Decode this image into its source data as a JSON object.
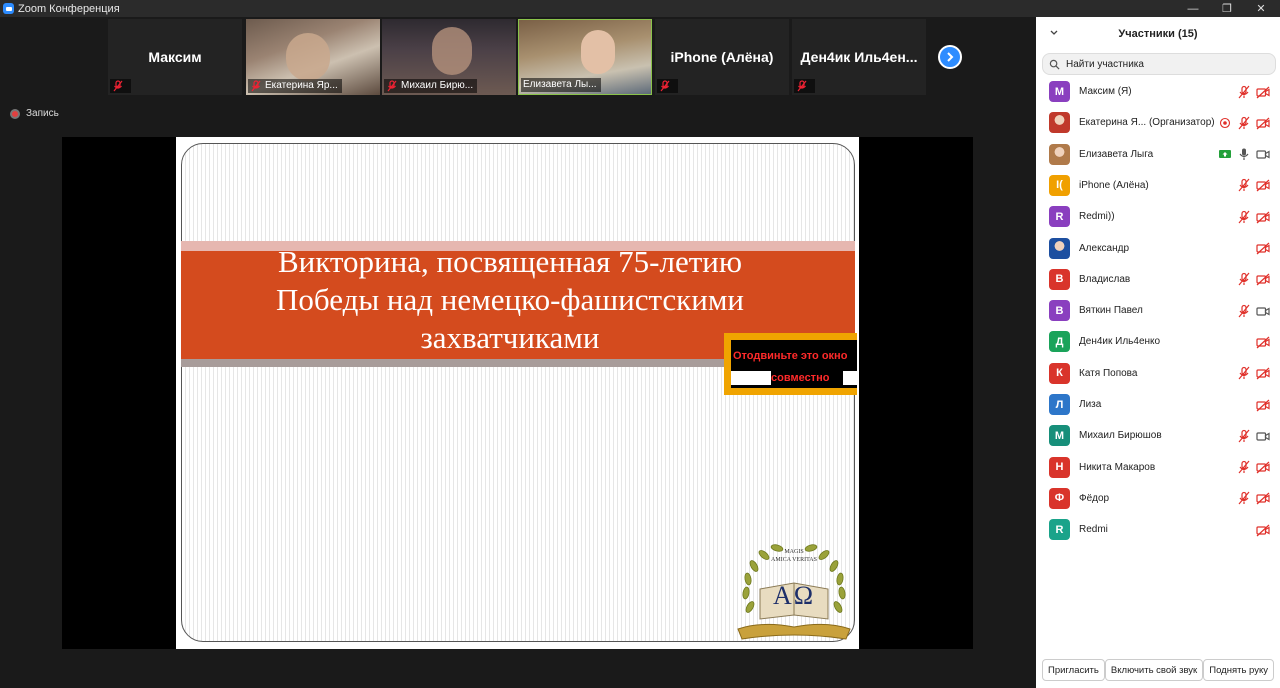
{
  "window": {
    "title": "Zoom Конференция"
  },
  "gallery": {
    "tiles": [
      {
        "name": "Максим",
        "kind": "name"
      },
      {
        "name": "Екатерина Яр...",
        "kind": "video"
      },
      {
        "name": "Михаил Бирю...",
        "kind": "video"
      },
      {
        "name": "Елизавета Лы...",
        "kind": "video"
      },
      {
        "name": "iPhone (Алёна)",
        "kind": "name"
      },
      {
        "name": "Ден4ик  Иль4ен...",
        "kind": "name"
      }
    ]
  },
  "recording": {
    "label": "Запись"
  },
  "slide": {
    "title_line1": "Викторина, посвященная 75-летию",
    "title_line2": "Победы над немецко-фашистскими",
    "title_line3": "захватчиками",
    "notice_line1": "Отодвиньте это окно",
    "notice_line2": "совместно",
    "emblem_text1": "MAGIS",
    "emblem_text2": "AMICA VERITAS",
    "emblem_letters": "ΑΩ"
  },
  "panel": {
    "title": "Участники (15)",
    "search_placeholder": "Найти участника",
    "participants": [
      {
        "name": "Максим  (Я)",
        "initial": "М",
        "color": "#8a3fbf",
        "mic": "off",
        "cam": "off"
      },
      {
        "name": "Екатерина Я...  (Организатор)",
        "initial": "",
        "color": "#c0392b",
        "mic": "off",
        "cam": "off",
        "rec": true
      },
      {
        "name": "Елизавета Лыга",
        "initial": "",
        "color": "#b07a4a",
        "mic": "on",
        "cam": "on",
        "share": true
      },
      {
        "name": "iPhone (Алёна)",
        "initial": "I(",
        "color": "#f0a000",
        "mic": "off",
        "cam": "off"
      },
      {
        "name": "Redmi))",
        "initial": "R",
        "color": "#8a3fbf",
        "mic": "off",
        "cam": "off"
      },
      {
        "name": "Александр",
        "initial": "",
        "color": "#1d4fa0",
        "mic": "",
        "cam": "off"
      },
      {
        "name": "Владислав",
        "initial": "В",
        "color": "#d9342b",
        "mic": "off",
        "cam": "off"
      },
      {
        "name": "Вяткин Павел",
        "initial": "В",
        "color": "#8a3fbf",
        "mic": "off",
        "cam": "on"
      },
      {
        "name": "Ден4ик Иль4енко",
        "initial": "Д",
        "color": "#1aa35a",
        "mic": "",
        "cam": "off"
      },
      {
        "name": "Катя Попова",
        "initial": "К",
        "color": "#d9342b",
        "mic": "off",
        "cam": "off"
      },
      {
        "name": "Лиза",
        "initial": "Л",
        "color": "#2d76c9",
        "mic": "",
        "cam": "off"
      },
      {
        "name": "Михаил Бирюшов",
        "initial": "М",
        "color": "#178f7a",
        "mic": "off",
        "cam": "on"
      },
      {
        "name": "Никита Макаров",
        "initial": "Н",
        "color": "#d9342b",
        "mic": "off",
        "cam": "off"
      },
      {
        "name": "Фёдор",
        "initial": "Ф",
        "color": "#d9342b",
        "mic": "off",
        "cam": "off"
      },
      {
        "name": "Redmi",
        "initial": "R",
        "color": "#1aa38a",
        "mic": "",
        "cam": "off"
      }
    ],
    "footer": {
      "invite": "Пригласить",
      "unmute": "Включить свой звук",
      "raise_hand": "Поднять руку"
    }
  }
}
